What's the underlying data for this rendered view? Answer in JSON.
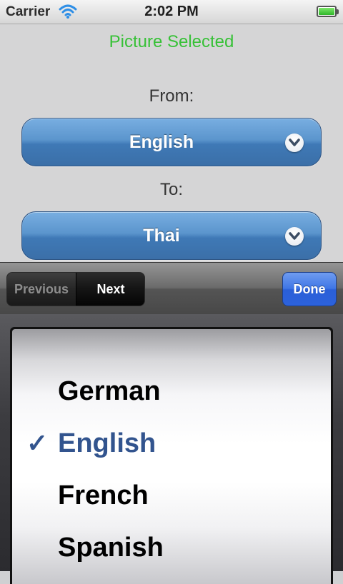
{
  "status_bar": {
    "carrier": "Carrier",
    "time": "2:02 PM",
    "battery_level": 1.0,
    "wifi_icon": "wifi-icon",
    "battery_icon": "battery-icon"
  },
  "main": {
    "picture_status": "Picture Selected",
    "from_label": "From:",
    "from_value": "English",
    "to_label": "To:",
    "to_value": "Thai",
    "dropdown_icon": "chevron-down-icon"
  },
  "toolbar": {
    "previous_label": "Previous",
    "next_label": "Next",
    "done_label": "Done"
  },
  "picker": {
    "items": [
      {
        "label": "German",
        "selected": false
      },
      {
        "label": "English",
        "selected": true
      },
      {
        "label": "French",
        "selected": false
      },
      {
        "label": "Spanish",
        "selected": false
      }
    ],
    "check_mark": "✓"
  },
  "colors": {
    "picture_status": "#37c137",
    "select_blue": "#4f88c3",
    "done_blue": "#3b72e3",
    "selected_text": "#32548e"
  }
}
